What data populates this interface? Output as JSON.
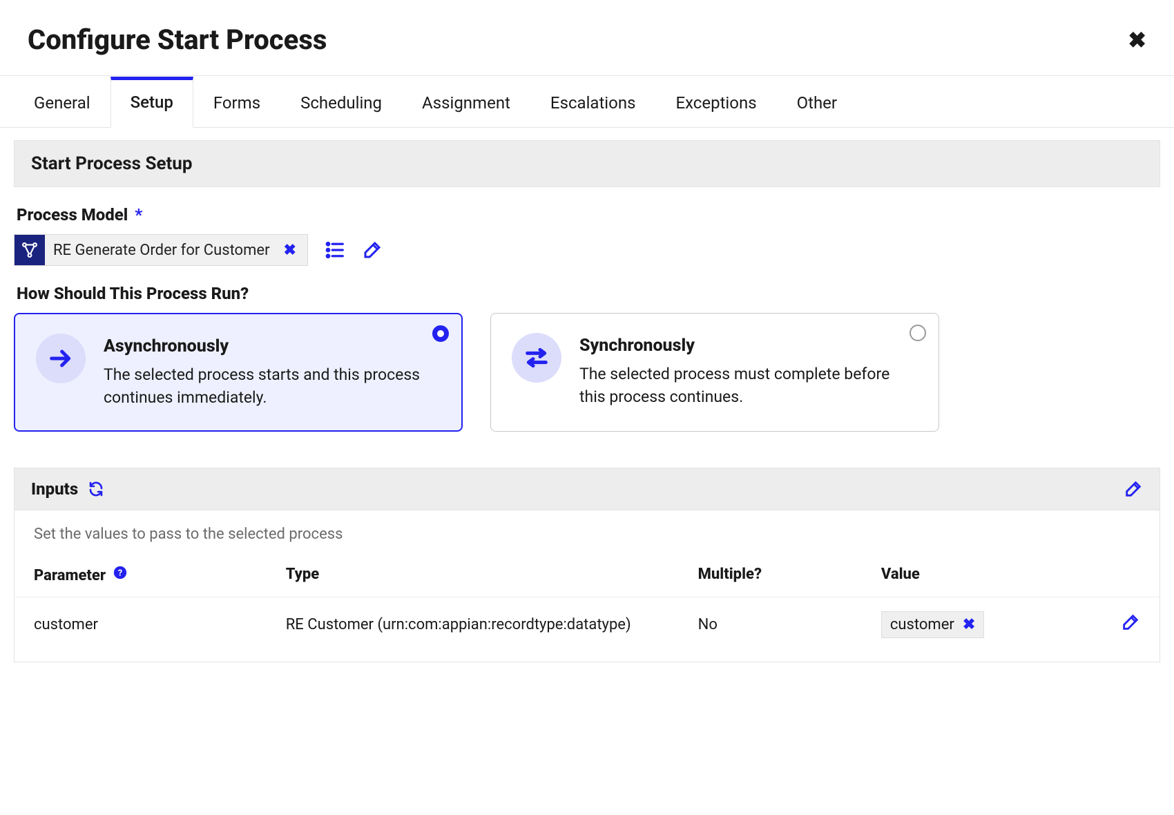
{
  "dialog": {
    "title": "Configure Start Process"
  },
  "tabs": [
    {
      "label": "General",
      "active": false
    },
    {
      "label": "Setup",
      "active": true
    },
    {
      "label": "Forms",
      "active": false
    },
    {
      "label": "Scheduling",
      "active": false
    },
    {
      "label": "Assignment",
      "active": false
    },
    {
      "label": "Escalations",
      "active": false
    },
    {
      "label": "Exceptions",
      "active": false
    },
    {
      "label": "Other",
      "active": false
    }
  ],
  "setup": {
    "section_title": "Start Process Setup",
    "process_model_label": "Process Model",
    "process_model_value": "RE Generate Order for Customer",
    "run_question": "How Should This Process Run?",
    "options": {
      "async": {
        "title": "Asynchronously",
        "desc": "The selected process starts and this process continues immediately."
      },
      "sync": {
        "title": "Synchronously",
        "desc": "The selected process must complete before this process continues."
      }
    }
  },
  "inputs": {
    "header": "Inputs",
    "hint": "Set the values to pass to the selected process",
    "columns": {
      "param": "Parameter",
      "type": "Type",
      "multiple": "Multiple?",
      "value": "Value"
    },
    "rows": [
      {
        "param": "customer",
        "type": "RE Customer (urn:com:appian:recordtype:datatype)",
        "multiple": "No",
        "value": "customer"
      }
    ]
  },
  "icons": {
    "close": "close-icon",
    "process_model": "process-model-icon",
    "list": "list-icon",
    "edit": "edit-icon",
    "arrow_right": "arrow-right-icon",
    "swap": "swap-icon",
    "refresh": "refresh-icon",
    "help": "help-icon"
  }
}
